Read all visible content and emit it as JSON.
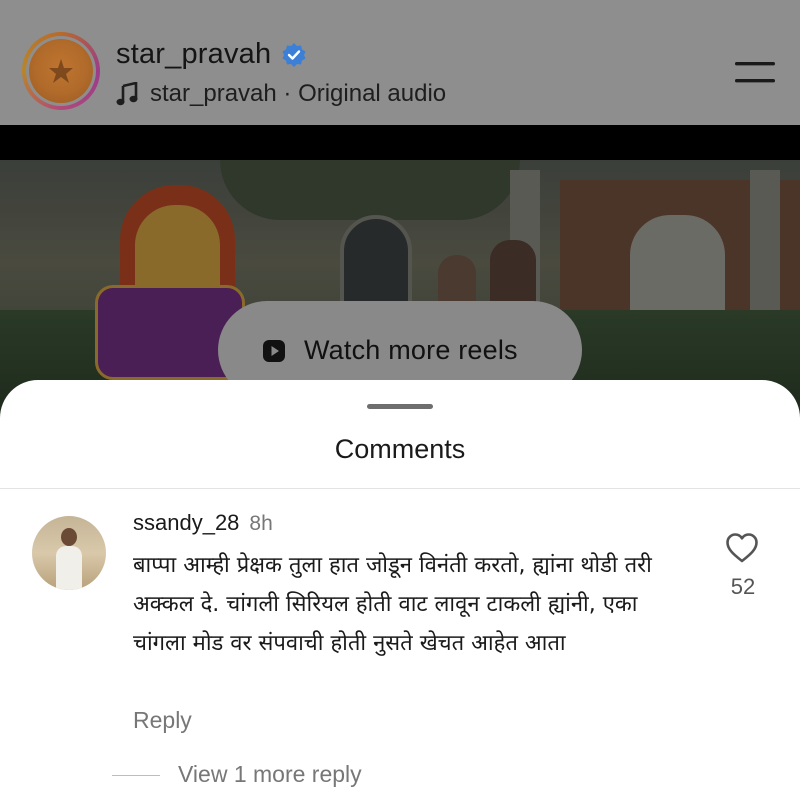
{
  "header": {
    "username": "star_pravah",
    "verified": true,
    "audio_label": "star_pravah · Original audio",
    "menu_icon": "hamburger-menu-icon"
  },
  "video": {
    "watch_more_label": "Watch more reels"
  },
  "comments": {
    "title": "Comments",
    "items": [
      {
        "username": "ssandy_28",
        "time": "8h",
        "text": "बाप्पा आम्ही प्रेक्षक तुला हात जोडून विनंती करतो, ह्यांना थोडी तरी अक्कल दे. चांगली सिरियल होती वाट लावून टाकली ह्यांनी, एका चांगला मोड वर संपवाची होती नुसते खेचत आहेत आता",
        "likes": "52",
        "reply_label": "Reply",
        "view_replies_label": "View 1 more reply"
      }
    ]
  },
  "colors": {
    "verified_blue": "#3b7fd6",
    "sheet_bg": "#ffffff",
    "dim_overlay": "#8e8e8e"
  }
}
